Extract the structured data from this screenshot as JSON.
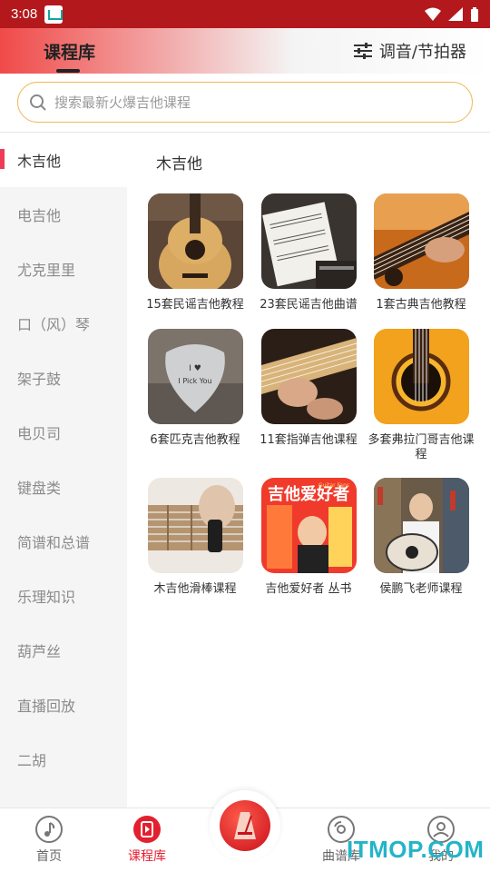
{
  "status_bar": {
    "time": "3:08"
  },
  "header": {
    "title": "课程库",
    "tuner_label": "调音/节拍器"
  },
  "search": {
    "placeholder": "搜索最新火爆吉他课程"
  },
  "sidebar": {
    "items": [
      {
        "label": "木吉他",
        "active": true
      },
      {
        "label": "电吉他"
      },
      {
        "label": "尤克里里"
      },
      {
        "label": "口（风）琴"
      },
      {
        "label": "架子鼓"
      },
      {
        "label": "电贝司"
      },
      {
        "label": "键盘类"
      },
      {
        "label": "简谱和总谱"
      },
      {
        "label": "乐理知识"
      },
      {
        "label": "葫芦丝"
      },
      {
        "label": "直播回放"
      },
      {
        "label": "二胡"
      }
    ]
  },
  "section": {
    "title": "木吉他"
  },
  "courses": [
    {
      "label": "15套民谣吉他教程"
    },
    {
      "label": "23套民谣吉他曲谱"
    },
    {
      "label": "1套古典吉他教程"
    },
    {
      "label": "6套匹克吉他教程"
    },
    {
      "label": "11套指弹吉他课程"
    },
    {
      "label": "多套弗拉门哥吉他课程"
    },
    {
      "label": "木吉他滑棒课程"
    },
    {
      "label": "吉他爱好者 丛书"
    },
    {
      "label": "侯鹏飞老师课程"
    }
  ],
  "thumb_text": {
    "magazine_title": "吉他爱好者",
    "magazine_en": "Guitar Fans",
    "pick_text": "I Pick You"
  },
  "tabbar": {
    "home": "首页",
    "courses": "课程库",
    "scores": "曲谱库",
    "mine": "我的"
  },
  "watermark": "ITMOP.COM",
  "colors": {
    "accent": "#e3202f",
    "header_red": "#f04a49",
    "search_border": "#f0b85a",
    "status_bar": "#b3191c"
  }
}
